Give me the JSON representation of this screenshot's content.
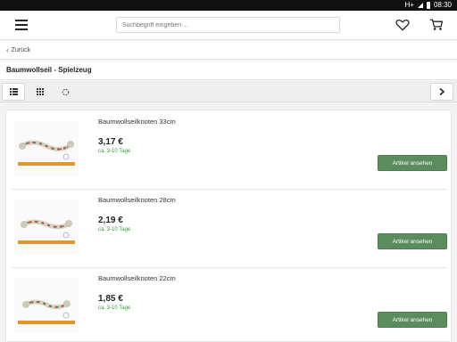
{
  "statusbar": {
    "network": "H+",
    "time": "08:30"
  },
  "header": {
    "search_placeholder": "Suchbegriff eingeben ...",
    "icons": [
      "menu-icon",
      "heart-icon",
      "cart-icon"
    ]
  },
  "nav": {
    "back_label": "Zurück"
  },
  "page": {
    "title": "Baumwollseil - Spielzeug"
  },
  "toolbar": {
    "views": [
      "list-view-icon",
      "grid-view-icon",
      "loading-icon"
    ],
    "next": "chevron-right-icon"
  },
  "products": [
    {
      "name": "Baumwollseilknoten 33cm",
      "price": "3,17 €",
      "delivery": "ca. 3-10 Tage",
      "button": "Artikel ansehen"
    },
    {
      "name": "Baumwollseilknoten 28cm",
      "price": "2,19 €",
      "delivery": "ca. 3-10 Tage",
      "button": "Artikel ansehen"
    },
    {
      "name": "Baumwollseilknoten 22cm",
      "price": "1,85 €",
      "delivery": "ca. 3-10 Tage",
      "button": "Artikel ansehen"
    }
  ],
  "colors": {
    "accent_button": "#5b8c5e",
    "delivery_text": "#3d9a3d"
  }
}
